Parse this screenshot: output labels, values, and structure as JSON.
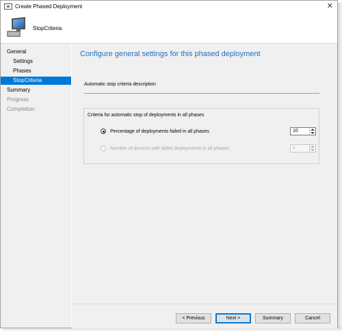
{
  "window": {
    "title": "Create Phased Deployment",
    "close_glyph": "✕",
    "icon": "app-window-icon"
  },
  "header": {
    "title": "StopCriteria",
    "icon": "computer-icon"
  },
  "sidebar": {
    "items": [
      {
        "label": "General",
        "level": 0,
        "state": "normal"
      },
      {
        "label": "Settings",
        "level": 1,
        "state": "normal"
      },
      {
        "label": "Phases",
        "level": 1,
        "state": "normal"
      },
      {
        "label": "StopCriteria",
        "level": 1,
        "state": "active"
      },
      {
        "label": "Summary",
        "level": 0,
        "state": "normal"
      },
      {
        "label": "Progress",
        "level": 0,
        "state": "disabled"
      },
      {
        "label": "Completion",
        "level": 0,
        "state": "disabled"
      }
    ]
  },
  "main": {
    "heading": "Configure general settings for this phased deployment",
    "section_label": "Automatic stop criteria description",
    "group": {
      "title": "Criteria for automatic stop of deployments in all phases",
      "options": [
        {
          "label": "Percentage of deployments failed in all phases",
          "checked": true,
          "enabled": true,
          "value": "10"
        },
        {
          "label": "Number of devices with failed deployments in all phases",
          "checked": false,
          "enabled": false,
          "value": "1"
        }
      ]
    }
  },
  "footer": {
    "previous_label": "< Previous",
    "next_label": "Next >",
    "summary_label": "Summary",
    "cancel_label": "Cancel"
  },
  "colors": {
    "accent": "#0078d7",
    "heading": "#1c6fc1",
    "panel_bg": "#f0f0f0"
  }
}
